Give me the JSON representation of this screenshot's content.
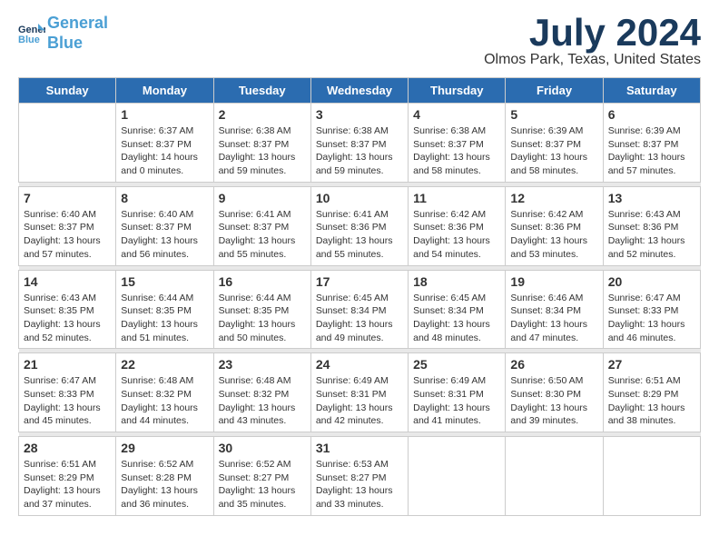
{
  "header": {
    "logo_line1": "General",
    "logo_line2": "Blue",
    "month_year": "July 2024",
    "location": "Olmos Park, Texas, United States"
  },
  "days_of_week": [
    "Sunday",
    "Monday",
    "Tuesday",
    "Wednesday",
    "Thursday",
    "Friday",
    "Saturday"
  ],
  "weeks": [
    [
      {
        "num": "",
        "info": ""
      },
      {
        "num": "1",
        "info": "Sunrise: 6:37 AM\nSunset: 8:37 PM\nDaylight: 14 hours\nand 0 minutes."
      },
      {
        "num": "2",
        "info": "Sunrise: 6:38 AM\nSunset: 8:37 PM\nDaylight: 13 hours\nand 59 minutes."
      },
      {
        "num": "3",
        "info": "Sunrise: 6:38 AM\nSunset: 8:37 PM\nDaylight: 13 hours\nand 59 minutes."
      },
      {
        "num": "4",
        "info": "Sunrise: 6:38 AM\nSunset: 8:37 PM\nDaylight: 13 hours\nand 58 minutes."
      },
      {
        "num": "5",
        "info": "Sunrise: 6:39 AM\nSunset: 8:37 PM\nDaylight: 13 hours\nand 58 minutes."
      },
      {
        "num": "6",
        "info": "Sunrise: 6:39 AM\nSunset: 8:37 PM\nDaylight: 13 hours\nand 57 minutes."
      }
    ],
    [
      {
        "num": "7",
        "info": "Sunrise: 6:40 AM\nSunset: 8:37 PM\nDaylight: 13 hours\nand 57 minutes."
      },
      {
        "num": "8",
        "info": "Sunrise: 6:40 AM\nSunset: 8:37 PM\nDaylight: 13 hours\nand 56 minutes."
      },
      {
        "num": "9",
        "info": "Sunrise: 6:41 AM\nSunset: 8:37 PM\nDaylight: 13 hours\nand 55 minutes."
      },
      {
        "num": "10",
        "info": "Sunrise: 6:41 AM\nSunset: 8:36 PM\nDaylight: 13 hours\nand 55 minutes."
      },
      {
        "num": "11",
        "info": "Sunrise: 6:42 AM\nSunset: 8:36 PM\nDaylight: 13 hours\nand 54 minutes."
      },
      {
        "num": "12",
        "info": "Sunrise: 6:42 AM\nSunset: 8:36 PM\nDaylight: 13 hours\nand 53 minutes."
      },
      {
        "num": "13",
        "info": "Sunrise: 6:43 AM\nSunset: 8:36 PM\nDaylight: 13 hours\nand 52 minutes."
      }
    ],
    [
      {
        "num": "14",
        "info": "Sunrise: 6:43 AM\nSunset: 8:35 PM\nDaylight: 13 hours\nand 52 minutes."
      },
      {
        "num": "15",
        "info": "Sunrise: 6:44 AM\nSunset: 8:35 PM\nDaylight: 13 hours\nand 51 minutes."
      },
      {
        "num": "16",
        "info": "Sunrise: 6:44 AM\nSunset: 8:35 PM\nDaylight: 13 hours\nand 50 minutes."
      },
      {
        "num": "17",
        "info": "Sunrise: 6:45 AM\nSunset: 8:34 PM\nDaylight: 13 hours\nand 49 minutes."
      },
      {
        "num": "18",
        "info": "Sunrise: 6:45 AM\nSunset: 8:34 PM\nDaylight: 13 hours\nand 48 minutes."
      },
      {
        "num": "19",
        "info": "Sunrise: 6:46 AM\nSunset: 8:34 PM\nDaylight: 13 hours\nand 47 minutes."
      },
      {
        "num": "20",
        "info": "Sunrise: 6:47 AM\nSunset: 8:33 PM\nDaylight: 13 hours\nand 46 minutes."
      }
    ],
    [
      {
        "num": "21",
        "info": "Sunrise: 6:47 AM\nSunset: 8:33 PM\nDaylight: 13 hours\nand 45 minutes."
      },
      {
        "num": "22",
        "info": "Sunrise: 6:48 AM\nSunset: 8:32 PM\nDaylight: 13 hours\nand 44 minutes."
      },
      {
        "num": "23",
        "info": "Sunrise: 6:48 AM\nSunset: 8:32 PM\nDaylight: 13 hours\nand 43 minutes."
      },
      {
        "num": "24",
        "info": "Sunrise: 6:49 AM\nSunset: 8:31 PM\nDaylight: 13 hours\nand 42 minutes."
      },
      {
        "num": "25",
        "info": "Sunrise: 6:49 AM\nSunset: 8:31 PM\nDaylight: 13 hours\nand 41 minutes."
      },
      {
        "num": "26",
        "info": "Sunrise: 6:50 AM\nSunset: 8:30 PM\nDaylight: 13 hours\nand 39 minutes."
      },
      {
        "num": "27",
        "info": "Sunrise: 6:51 AM\nSunset: 8:29 PM\nDaylight: 13 hours\nand 38 minutes."
      }
    ],
    [
      {
        "num": "28",
        "info": "Sunrise: 6:51 AM\nSunset: 8:29 PM\nDaylight: 13 hours\nand 37 minutes."
      },
      {
        "num": "29",
        "info": "Sunrise: 6:52 AM\nSunset: 8:28 PM\nDaylight: 13 hours\nand 36 minutes."
      },
      {
        "num": "30",
        "info": "Sunrise: 6:52 AM\nSunset: 8:27 PM\nDaylight: 13 hours\nand 35 minutes."
      },
      {
        "num": "31",
        "info": "Sunrise: 6:53 AM\nSunset: 8:27 PM\nDaylight: 13 hours\nand 33 minutes."
      },
      {
        "num": "",
        "info": ""
      },
      {
        "num": "",
        "info": ""
      },
      {
        "num": "",
        "info": ""
      }
    ]
  ]
}
